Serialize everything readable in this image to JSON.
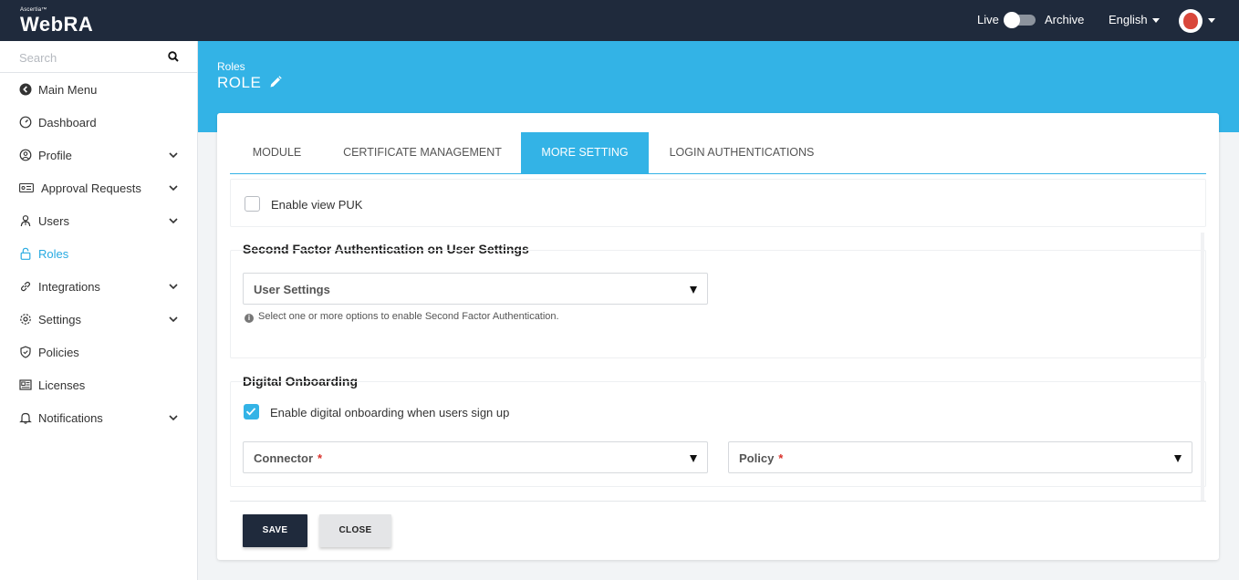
{
  "topbar": {
    "brand_small": "Ascertia™",
    "brand": "WebRA",
    "live_label": "Live",
    "archive_label": "Archive",
    "language": "English"
  },
  "sidebar": {
    "search_placeholder": "Search",
    "items": [
      {
        "label": "Main Menu",
        "icon": "back-circle-icon"
      },
      {
        "label": "Dashboard",
        "icon": "gauge-icon"
      },
      {
        "label": "Profile",
        "icon": "user-circle-icon",
        "has_submenu": true
      },
      {
        "label": "Approval Requests",
        "icon": "id-card-icon",
        "has_submenu": true
      },
      {
        "label": "Users",
        "icon": "users-icon",
        "has_submenu": true
      },
      {
        "label": "Roles",
        "icon": "lock-icon",
        "active": true
      },
      {
        "label": "Integrations",
        "icon": "link-icon",
        "has_submenu": true
      },
      {
        "label": "Settings",
        "icon": "gear-icon",
        "has_submenu": true
      },
      {
        "label": "Policies",
        "icon": "shield-icon"
      },
      {
        "label": "Licenses",
        "icon": "license-icon"
      },
      {
        "label": "Notifications",
        "icon": "bell-icon",
        "has_submenu": true
      }
    ]
  },
  "header": {
    "breadcrumb": "Roles",
    "title": "ROLE"
  },
  "tabs": [
    {
      "label": "MODULE"
    },
    {
      "label": "CERTIFICATE MANAGEMENT"
    },
    {
      "label": "MORE SETTING",
      "active": true
    },
    {
      "label": "LOGIN AUTHENTICATIONS"
    }
  ],
  "more_setting": {
    "enable_view_puk_label": "Enable view PUK",
    "enable_view_puk_checked": false,
    "second_factor_title": "Second Factor Authentication on User Settings",
    "user_settings_value": "User Settings",
    "second_factor_hint": "Select one or more options to enable Second Factor Authentication.",
    "digital_onboarding_title": "Digital Onboarding",
    "enable_onboarding_label": "Enable digital onboarding when users sign up",
    "enable_onboarding_checked": true,
    "connector_label": "Connector",
    "policy_label": "Policy",
    "required_mark": "*"
  },
  "buttons": {
    "save": "SAVE",
    "close": "CLOSE"
  },
  "colors": {
    "topbar": "#1f2a3c",
    "accent": "#33b3e6",
    "active_menu": "#27aae1"
  }
}
